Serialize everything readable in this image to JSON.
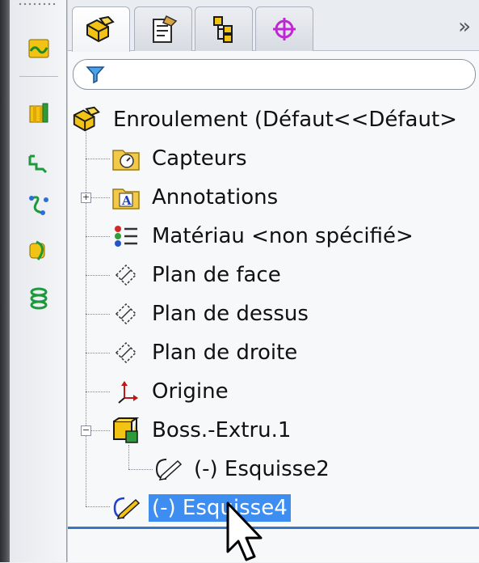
{
  "toolbar": {
    "tools": [
      {
        "icon": "sheet-metal-icon"
      },
      {
        "icon": "extrude-column-icon"
      },
      {
        "icon": "flat-pattern-icon"
      },
      {
        "icon": "curve-through-points-icon"
      },
      {
        "icon": "wrap-surface-icon"
      },
      {
        "icon": "helix-icon"
      }
    ]
  },
  "tabs": {
    "items": [
      {
        "icon": "feature-manager-icon",
        "active": true
      },
      {
        "icon": "property-manager-icon",
        "active": false
      },
      {
        "icon": "configuration-manager-icon",
        "active": false
      },
      {
        "icon": "dimxpert-manager-icon",
        "active": false
      }
    ],
    "more": "»"
  },
  "filter": {
    "icon": "filter-icon",
    "value": ""
  },
  "tree": {
    "root": "Enroulement  (Défaut<<Défaut>",
    "items": [
      {
        "label": "Capteurs",
        "icon": "sensors-folder-icon"
      },
      {
        "label": "Annotations",
        "icon": "annotations-folder-icon",
        "expander": "+"
      },
      {
        "label": "Matériau <non spécifié>",
        "icon": "material-icon"
      },
      {
        "label": "Plan de face",
        "icon": "plane-icon"
      },
      {
        "label": "Plan de dessus",
        "icon": "plane-icon"
      },
      {
        "label": "Plan de droite",
        "icon": "plane-icon"
      },
      {
        "label": "Origine",
        "icon": "origin-icon"
      },
      {
        "label": "Boss.-Extru.1",
        "icon": "boss-extrude-icon",
        "expander": "−"
      },
      {
        "label": "(-) Esquisse2",
        "icon": "sketch-icon"
      },
      {
        "label": "(-) Esquisse4",
        "icon": "sketch-icon",
        "selected": true
      }
    ]
  },
  "colors": {
    "selection": "#3d8ef0",
    "accent_line": "#3876c6"
  }
}
